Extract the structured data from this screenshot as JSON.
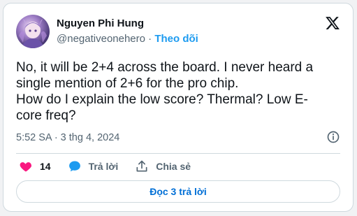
{
  "author": {
    "name": "Nguyen Phi Hung",
    "handle": "@negativeonehero",
    "separator": " · ",
    "follow_label": "Theo dõi",
    "avatar_icon": "anime-character-avatar"
  },
  "brand": {
    "icon": "x-logo-icon"
  },
  "tweet": {
    "text": "No, it will be 2+4 across the board. I never heard a\nsingle mention of 2+6 for the pro chip.\nHow do I explain the low score? Thermal? Low E-\ncore freq?",
    "time": "5:52 SA · 3 thg 4, 2024"
  },
  "actions": {
    "like_count": "14",
    "reply_label": "Trả lời",
    "share_label": "Chia sẻ"
  },
  "footer": {
    "read_replies_label": "Đọc 3 trả lời"
  },
  "colors": {
    "accent": "#1d9bf0",
    "like": "#f91880",
    "reply_icon": "#1d9bf0",
    "muted_text": "#536471",
    "read_replies_text": "#006fd6"
  }
}
